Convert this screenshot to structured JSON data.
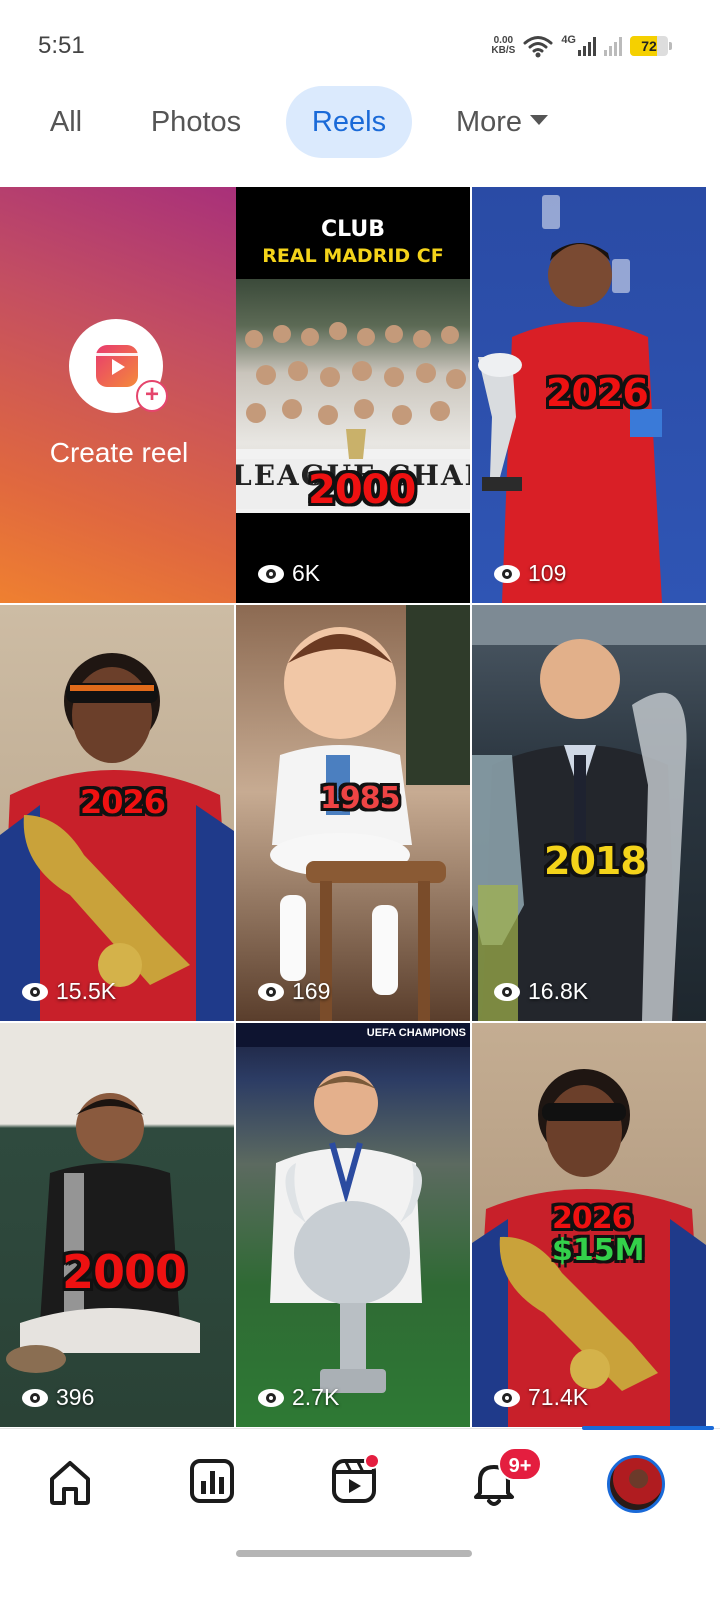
{
  "status_bar": {
    "time": "5:51",
    "net_speed_value": "0.00",
    "net_speed_unit": "KB/S",
    "network_type": "4G",
    "battery_level": 72,
    "battery_text": "72"
  },
  "tabs": [
    {
      "label": "All",
      "active": false
    },
    {
      "label": "Photos",
      "active": false
    },
    {
      "label": "Reels",
      "active": true
    },
    {
      "label": "More",
      "active": false
    }
  ],
  "create_reel": {
    "label": "Create reel"
  },
  "reels": [
    {
      "overlay_top_1": "CLUB",
      "overlay_top_2": "REAL MADRID CF",
      "overlay_banner": "LEAGUE CHAMPIONS",
      "overlay_year": "2000",
      "views": "6K"
    },
    {
      "overlay_year": "2026",
      "views": "109"
    },
    {
      "overlay_year": "2026",
      "views": "15.5K"
    },
    {
      "overlay_year": "1985",
      "views": "169"
    },
    {
      "overlay_year": "2018",
      "views": "16.8K"
    },
    {
      "overlay_year": "2000",
      "views": "396"
    },
    {
      "overlay_banner": "UEFA CHAMPIONS",
      "views": "2.7K"
    },
    {
      "overlay_year": "2026",
      "overlay_money": "$15M",
      "views": "71.4K"
    }
  ],
  "bottom_nav": {
    "items": [
      "home-icon",
      "stats-icon",
      "reels-icon",
      "bell-icon",
      "profile-avatar"
    ],
    "notifications_badge": "9+",
    "active": "profile"
  },
  "colors": {
    "accent": "#1a6ad8",
    "badge": "#e41e3f",
    "active_tab_bg": "#dbeafd"
  }
}
